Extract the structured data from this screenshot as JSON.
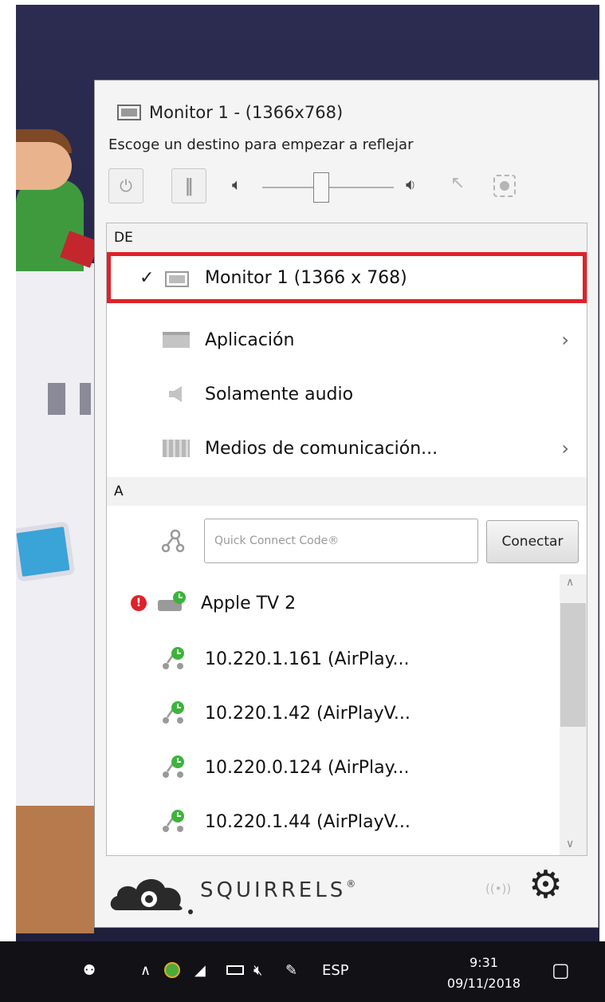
{
  "popup": {
    "title": "Monitor 1 - (1366x768)",
    "subtitle": "Escoge un destino para empezar a reflejar",
    "volume_fraction": 0.45
  },
  "source": {
    "header": "DE",
    "items": [
      {
        "label": "Monitor 1 (1366 x 768)",
        "selected": true
      },
      {
        "label": "Aplicación"
      },
      {
        "label": "Solamente audio"
      },
      {
        "label": "Medios de comunicación..."
      }
    ]
  },
  "target": {
    "header": "A",
    "quick_connect_placeholder": "Quick Connect Code®",
    "connect_label": "Conectar",
    "devices": [
      {
        "label": "Apple TV 2",
        "alert": "!"
      },
      {
        "label": "10.220.1.161 (AirPlay..."
      },
      {
        "label": "10.220.1.42 (AirPlayV..."
      },
      {
        "label": "10.220.0.124 (AirPlay..."
      },
      {
        "label": "10.220.1.44 (AirPlayV..."
      }
    ]
  },
  "footer": {
    "brand": "SQUIRRELS",
    "brand_mark": "®"
  },
  "taskbar": {
    "language": "ESP",
    "time": "9:31",
    "date": "09/11/2018"
  },
  "colors": {
    "highlight": "#e02129",
    "status_green": "#3cb43c"
  },
  "icons": [
    "monitor-icon",
    "power-icon",
    "pause-icon",
    "speaker-low-icon",
    "speaker-high-icon",
    "cursor-icon",
    "record-region-icon",
    "checkmark-icon",
    "application-icon",
    "audio-icon",
    "media-icon",
    "chevron-right-icon",
    "quick-connect-icon",
    "alert-icon",
    "appletv-icon",
    "airplay-node-icon",
    "cloud-logo-icon",
    "broadcast-icon",
    "gear-icon",
    "people-icon",
    "chevron-up-icon",
    "network-icon",
    "wifi-icon",
    "battery-icon",
    "volume-muted-icon",
    "pen-icon",
    "notification-icon"
  ]
}
